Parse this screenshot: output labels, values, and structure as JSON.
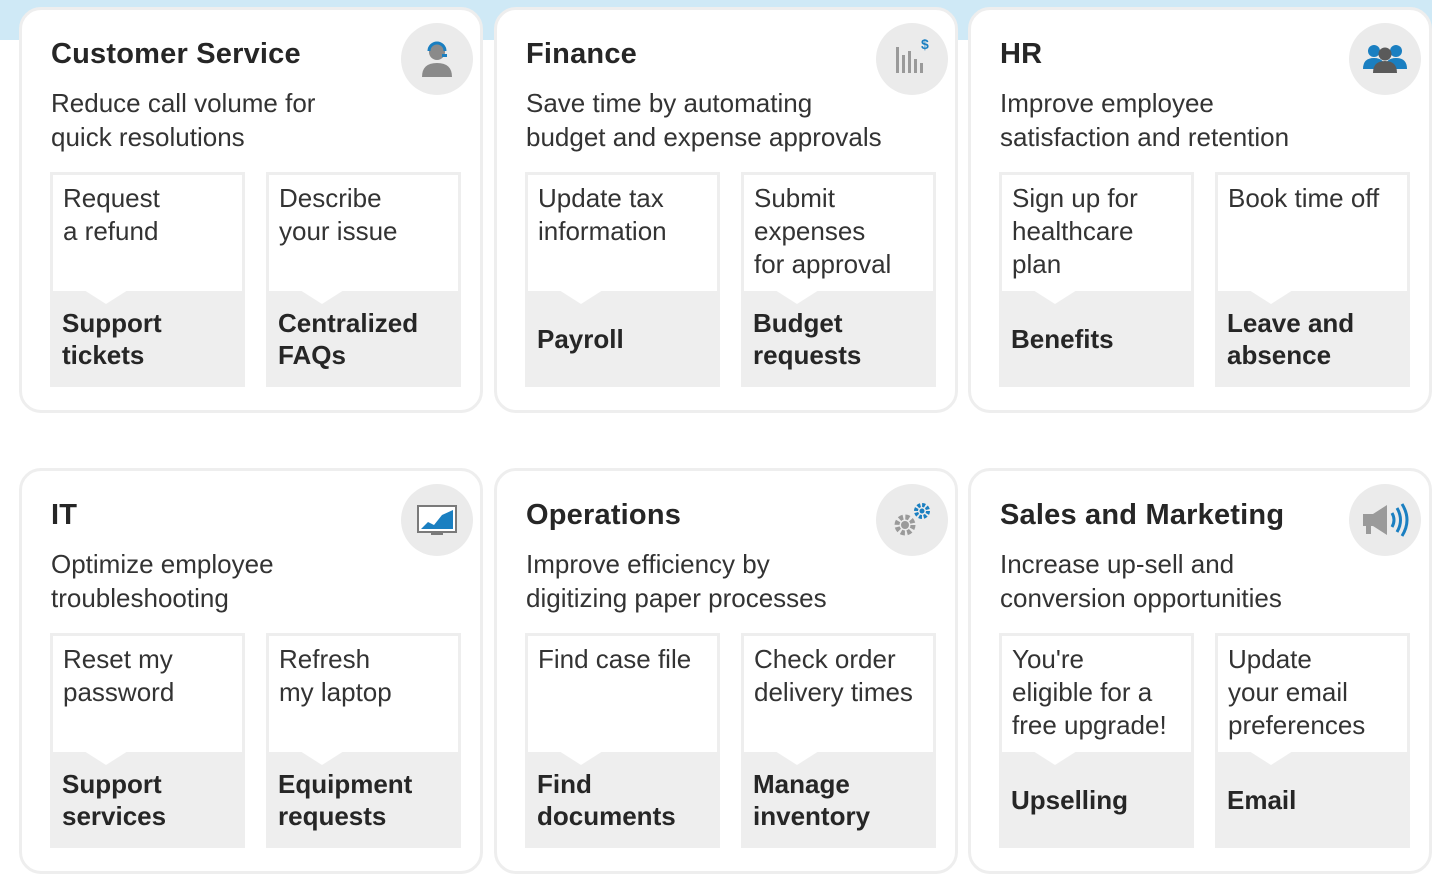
{
  "accent_color": "#1a7fc1",
  "cards": [
    {
      "title": "Customer Service",
      "description": "Reduce call volume for\nquick resolutions",
      "icon": "agent-icon",
      "tiles": [
        {
          "message": "Request\na refund",
          "label": "Support\ntickets"
        },
        {
          "message": "Describe\nyour issue",
          "label": "Centralized\nFAQs"
        }
      ]
    },
    {
      "title": "Finance",
      "description": "Save time by automating\nbudget and expense approvals",
      "icon": "finance-chart-icon",
      "tiles": [
        {
          "message": "Update tax\ninformation",
          "label": "Payroll"
        },
        {
          "message": "Submit\nexpenses\nfor approval",
          "label": "Budget\nrequests"
        }
      ]
    },
    {
      "title": "HR",
      "description": "Improve employee\nsatisfaction and retention",
      "icon": "people-icon",
      "tiles": [
        {
          "message": "Sign up for\nhealthcare\nplan",
          "label": "Benefits"
        },
        {
          "message": "Book time off",
          "label": "Leave and\nabsence"
        }
      ]
    },
    {
      "title": "IT",
      "description": "Optimize employee\ntroubleshooting",
      "icon": "monitor-chart-icon",
      "tiles": [
        {
          "message": "Reset my\npassword",
          "label": "Support\nservices"
        },
        {
          "message": "Refresh\nmy laptop",
          "label": "Equipment\nrequests"
        }
      ]
    },
    {
      "title": "Operations",
      "description": "Improve efficiency by\ndigitizing paper processes",
      "icon": "gears-icon",
      "tiles": [
        {
          "message": "Find case file",
          "label": "Find\ndocuments"
        },
        {
          "message": "Check order\ndelivery times",
          "label": "Manage\ninventory"
        }
      ]
    },
    {
      "title": "Sales and Marketing",
      "description": "Increase up-sell and\nconversion opportunities",
      "icon": "megaphone-icon",
      "tiles": [
        {
          "message": "You're\neligible for a\nfree upgrade!",
          "label": "Upselling"
        },
        {
          "message": "Update\nyour email\npreferences",
          "label": "Email"
        }
      ]
    }
  ]
}
